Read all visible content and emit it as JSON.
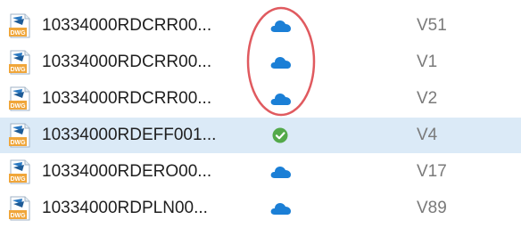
{
  "files": [
    {
      "name": "10334000RDCRR00...",
      "status": "cloud-icon",
      "version": "V51",
      "selected": false
    },
    {
      "name": "10334000RDCRR00...",
      "status": "cloud-icon",
      "version": "V1",
      "selected": false
    },
    {
      "name": "10334000RDCRR00...",
      "status": "cloud-icon",
      "version": "V2",
      "selected": false
    },
    {
      "name": "10334000RDEFF001...",
      "status": "check-circle-icon",
      "version": "V4",
      "selected": true
    },
    {
      "name": "10334000RDERO00...",
      "status": "cloud-icon",
      "version": "V17",
      "selected": false
    },
    {
      "name": "10334000RDPLN00...",
      "status": "cloud-icon",
      "version": "V89",
      "selected": false
    }
  ],
  "file_icon": {
    "name": "dwg-file-icon",
    "label": "DWG"
  },
  "colors": {
    "cloud": "#1b7fd6",
    "synced": "#53a94a",
    "selected_row": "#dbeaf7",
    "highlight": "#e05a5f",
    "version_text": "#7a7a7a"
  }
}
